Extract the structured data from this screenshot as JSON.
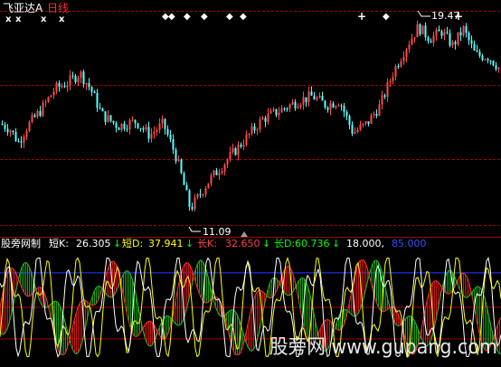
{
  "chart_data": {
    "type": "candlestick",
    "panels": [
      {
        "id": "price",
        "stock_name": "飞亚达A",
        "period": "日线",
        "annotations": {
          "high": "19.47",
          "low": "11.09"
        },
        "markers": {
          "x_marks": [
            "x",
            "x",
            "x",
            "x"
          ],
          "diamonds": [
            "◆",
            "◆",
            "◆",
            "◆",
            "◆",
            "◆",
            "◆"
          ],
          "plus_marks": [
            "+",
            "+",
            "+"
          ]
        },
        "grid": "dashed red horizontal lines"
      },
      {
        "id": "oscillator",
        "indicator": "股旁网制",
        "readouts": [
          {
            "label": "短K:",
            "value": "26.305",
            "arrow": "↓",
            "color": "#ffffff"
          },
          {
            "label": "短D:",
            "value": "37.941",
            "arrow": "↓",
            "color": "#ffff00"
          },
          {
            "label": "长K:",
            "value": "32.650",
            "arrow": "↓",
            "color": "#ff4040"
          },
          {
            "label": "长D:",
            "value": "60.736",
            "arrow": "↓",
            "color": "#00ff00"
          },
          {
            "label": "",
            "value": "18.000,",
            "arrow": "",
            "color": "#ffffff"
          },
          {
            "label": "",
            "value": "85.000",
            "arrow": "",
            "color": "#3050ff"
          }
        ],
        "reference_levels": [
          18,
          85
        ]
      }
    ]
  },
  "watermark": "股旁网 www.gupang.com",
  "colors": {
    "background": "#000000",
    "up": "#ff4a4a",
    "down": "#54ffff",
    "grid": "#a00000",
    "level_blue": "#2030ff",
    "fill_red": "#d01818",
    "fill_green": "#18a018"
  }
}
